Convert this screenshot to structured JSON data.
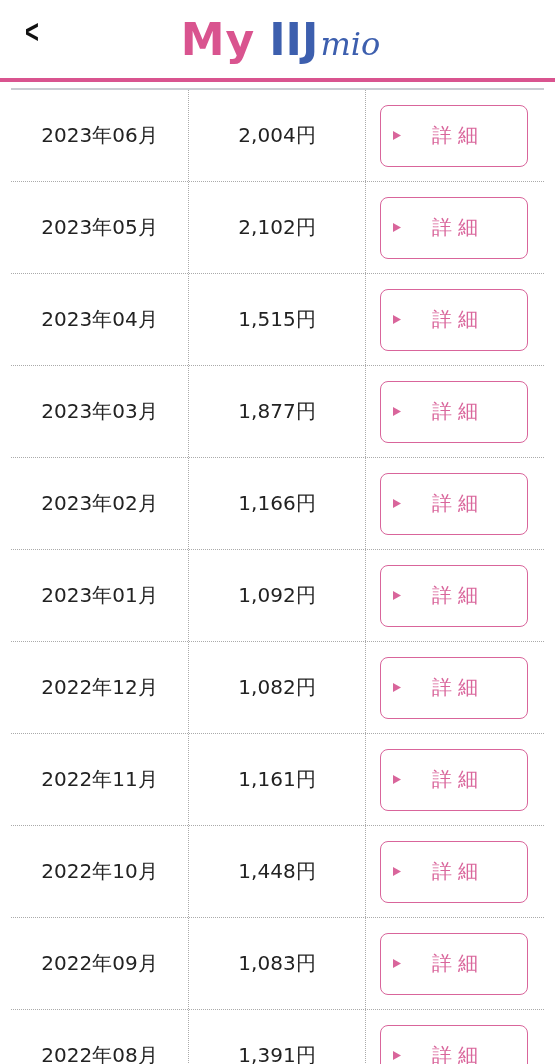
{
  "header": {
    "back": "<",
    "logo": {
      "my": "My",
      "iij": "IIJ",
      "mio": "mio"
    }
  },
  "rows": [
    {
      "month": "2023年06月",
      "amount": "2,004円",
      "button": "詳 細"
    },
    {
      "month": "2023年05月",
      "amount": "2,102円",
      "button": "詳 細"
    },
    {
      "month": "2023年04月",
      "amount": "1,515円",
      "button": "詳 細"
    },
    {
      "month": "2023年03月",
      "amount": "1,877円",
      "button": "詳 細"
    },
    {
      "month": "2023年02月",
      "amount": "1,166円",
      "button": "詳 細"
    },
    {
      "month": "2023年01月",
      "amount": "1,092円",
      "button": "詳 細"
    },
    {
      "month": "2022年12月",
      "amount": "1,082円",
      "button": "詳 細"
    },
    {
      "month": "2022年11月",
      "amount": "1,161円",
      "button": "詳 細"
    },
    {
      "month": "2022年10月",
      "amount": "1,448円",
      "button": "詳 細"
    },
    {
      "month": "2022年09月",
      "amount": "1,083円",
      "button": "詳 細"
    },
    {
      "month": "2022年08月",
      "amount": "1,391円",
      "button": "詳 細"
    }
  ]
}
